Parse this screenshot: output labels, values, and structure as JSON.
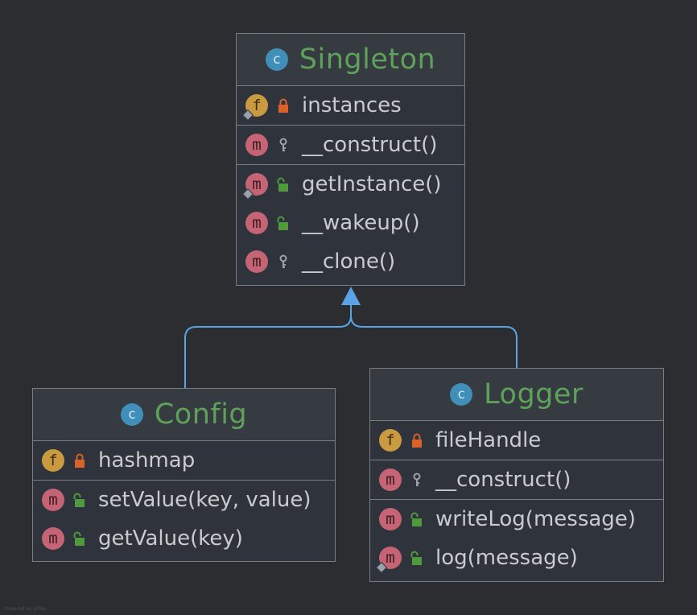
{
  "colors": {
    "background": "#2b2d30",
    "class_name": "#5ea15a",
    "member_text": "#c9cbcf",
    "field_badge": "#c99a3f",
    "method_badge": "#c46474",
    "class_badge": "#3f8fb8",
    "private_lock": "#d9622b",
    "public_lock": "#4e9a3d",
    "edge": "#5aa4e6"
  },
  "classes": {
    "singleton": {
      "kind": "c",
      "name": "Singleton",
      "fields": [
        {
          "badge": "f",
          "visibility": "private",
          "static": true,
          "label": "instances"
        }
      ],
      "constructors": [
        {
          "badge": "m",
          "visibility": "protected",
          "static": false,
          "label": "__construct()"
        }
      ],
      "methods": [
        {
          "badge": "m",
          "visibility": "public",
          "static": true,
          "label": "getInstance()"
        },
        {
          "badge": "m",
          "visibility": "public",
          "static": false,
          "label": "__wakeup()"
        },
        {
          "badge": "m",
          "visibility": "protected",
          "static": false,
          "label": "__clone()"
        }
      ]
    },
    "config": {
      "kind": "c",
      "name": "Config",
      "fields": [
        {
          "badge": "f",
          "visibility": "private",
          "static": false,
          "label": "hashmap"
        }
      ],
      "methods": [
        {
          "badge": "m",
          "visibility": "public",
          "static": false,
          "label": "setValue(key, value)"
        },
        {
          "badge": "m",
          "visibility": "public",
          "static": false,
          "label": "getValue(key)"
        }
      ]
    },
    "logger": {
      "kind": "c",
      "name": "Logger",
      "fields": [
        {
          "badge": "f",
          "visibility": "private",
          "static": false,
          "label": "fileHandle"
        }
      ],
      "constructors": [
        {
          "badge": "m",
          "visibility": "protected",
          "static": false,
          "label": "__construct()"
        }
      ],
      "methods": [
        {
          "badge": "m",
          "visibility": "public",
          "static": false,
          "label": "writeLog(message)"
        },
        {
          "badge": "m",
          "visibility": "public",
          "static": true,
          "label": "log(message)"
        }
      ]
    }
  },
  "edges": [
    {
      "from": "config",
      "to": "singleton",
      "type": "inheritance"
    },
    {
      "from": "logger",
      "to": "singleton",
      "type": "inheritance"
    }
  ],
  "footer": "Powered by yFiles"
}
